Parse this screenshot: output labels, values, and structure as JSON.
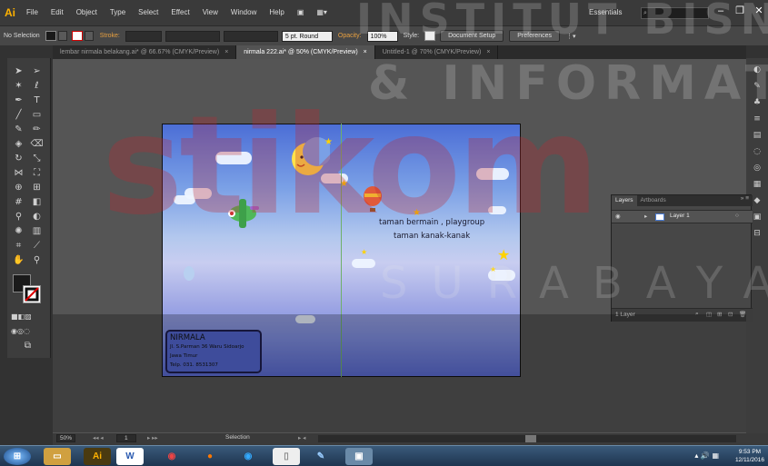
{
  "app": {
    "logo": "Ai",
    "workspace": "Essentials"
  },
  "menu": [
    "File",
    "Edit",
    "Object",
    "Type",
    "Select",
    "Effect",
    "View",
    "Window",
    "Help"
  ],
  "control_bar": {
    "selection": "No Selection",
    "stroke_label": "Stroke:",
    "brush": "5 pt. Round",
    "opacity_label": "Opacity:",
    "opacity": "100%",
    "style_label": "Style:",
    "document_setup": "Document Setup",
    "preferences": "Preferences"
  },
  "tabs": [
    {
      "label": "lembar nirmala belakang.ai* @ 66.67% (CMYK/Preview)",
      "close": "×"
    },
    {
      "label": "nirmala 222.ai* @ 50% (CMYK/Preview)",
      "close": "×"
    },
    {
      "label": "Untitled-1 @ 70% (CMYK/Preview)",
      "close": "×"
    }
  ],
  "artwork": {
    "tagline1": "taman bermain , playgroup",
    "tagline2": "taman kanak-kanak",
    "info": {
      "name": "NIRMALA",
      "address": "Jl. S.Parman 36 Waru Sidoarjo",
      "city": "Jawa Timur",
      "phone": "Telp. 031. 8531307"
    }
  },
  "layers_panel": {
    "tabs": [
      "Layers",
      "Artboards"
    ],
    "layer": "Layer 1",
    "footer": "1 Layer"
  },
  "status_bar": {
    "zoom": "50%",
    "page": "1",
    "tool": "Selection"
  },
  "taskbar": {
    "time": "9:53 PM",
    "date": "12/11/2016"
  },
  "watermark": {
    "institute": "INSTITUT BISNIS",
    "info": "& INFORMATIKA",
    "logo": "stikom",
    "city": "SURABAYA"
  },
  "colors": {
    "accent": "#ffb200",
    "artboard_top": "#4c6ed6",
    "artboard_bottom": "#5a6ad0",
    "selected_layer": "#4a7cd6"
  }
}
